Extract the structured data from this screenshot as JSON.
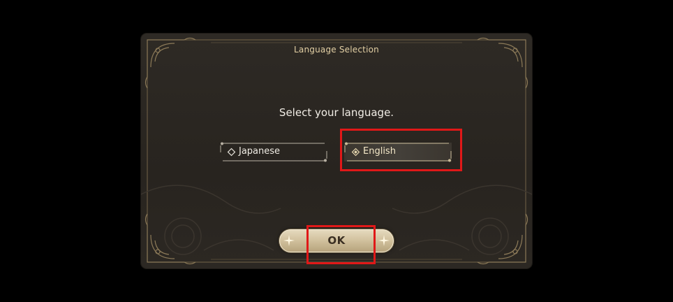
{
  "dialog": {
    "title": "Language Selection",
    "prompt": "Select your language."
  },
  "languages": [
    {
      "label": "Japanese",
      "selected": false
    },
    {
      "label": "English",
      "selected": true
    }
  ],
  "ok_button": {
    "label": "OK"
  },
  "colors": {
    "background": "#000000",
    "dialog_bg": "#2a2621",
    "title_gold": "#e2cfa4",
    "ornament_gold": "#8c7a58",
    "button_gold": "#d6c6a2",
    "highlight_red": "#e01818"
  },
  "icons": {
    "option_marker": "diamond-icon",
    "button_ornament": "sparkle-icon",
    "corner": "ornate-corner-icon"
  }
}
